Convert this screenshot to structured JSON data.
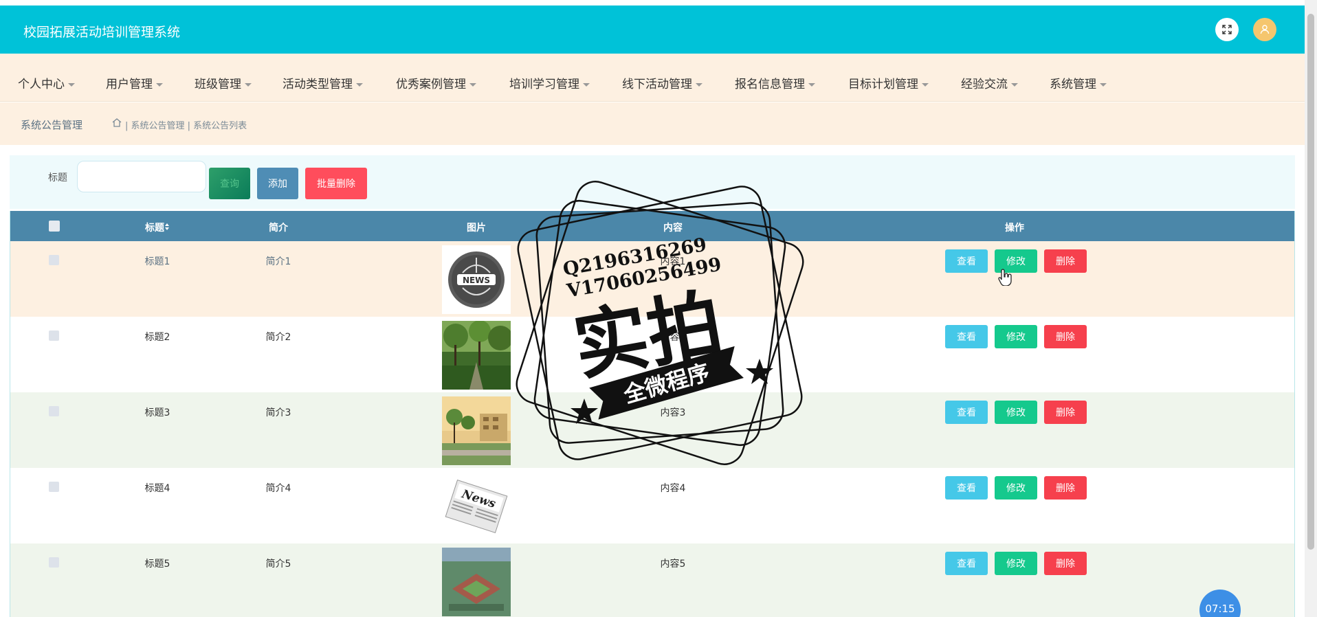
{
  "header": {
    "title": "校园拓展活动培训管理系统",
    "fullscreen_icon": "fullscreen-icon",
    "user_icon": "user-icon",
    "colors": {
      "bar": "#00c2d8",
      "user_avatar": "#f5c66e"
    }
  },
  "nav": {
    "items": [
      {
        "label": "个人中心"
      },
      {
        "label": "用户管理"
      },
      {
        "label": "班级管理"
      },
      {
        "label": "活动类型管理"
      },
      {
        "label": "优秀案例管理"
      },
      {
        "label": "培训学习管理"
      },
      {
        "label": "线下活动管理"
      },
      {
        "label": "报名信息管理"
      },
      {
        "label": "目标计划管理"
      },
      {
        "label": "经验交流"
      },
      {
        "label": "系统管理"
      }
    ]
  },
  "breadcrumb": {
    "section": "系统公告管理",
    "home_icon": "home-icon",
    "path": "| 系统公告管理 | 系统公告列表"
  },
  "search": {
    "label": "标题",
    "value": "",
    "placeholder": "",
    "search_button": "查询",
    "add_button": "添加",
    "batch_delete_button": "批量删除"
  },
  "table": {
    "columns": [
      "标题",
      "简介",
      "图片",
      "内容",
      "操作"
    ],
    "sort_icon": "sort-icon",
    "rows": [
      {
        "title": "标题1",
        "intro": "简介1",
        "image": "news-globe",
        "content": "内容1",
        "bg": "#fdf0e1"
      },
      {
        "title": "标题2",
        "intro": "简介2",
        "image": "park-trees",
        "content": "内容2",
        "bg": "#ffffff"
      },
      {
        "title": "标题3",
        "intro": "简介3",
        "image": "campus-sunset",
        "content": "内容3",
        "bg": "#eff5ec"
      },
      {
        "title": "标题4",
        "intro": "简介4",
        "image": "newspaper",
        "content": "内容4",
        "bg": "#ffffff"
      },
      {
        "title": "标题5",
        "intro": "简介5",
        "image": "aerial-building",
        "content": "内容5",
        "bg": "#eff5ec"
      }
    ],
    "actions": {
      "view": "查看",
      "edit": "修改",
      "delete": "删除"
    }
  },
  "watermark": {
    "qq": "Q2196316269",
    "wechat": "V17060256499",
    "main": "实拍",
    "ribbon": "全微程序"
  },
  "timer": "07:15"
}
